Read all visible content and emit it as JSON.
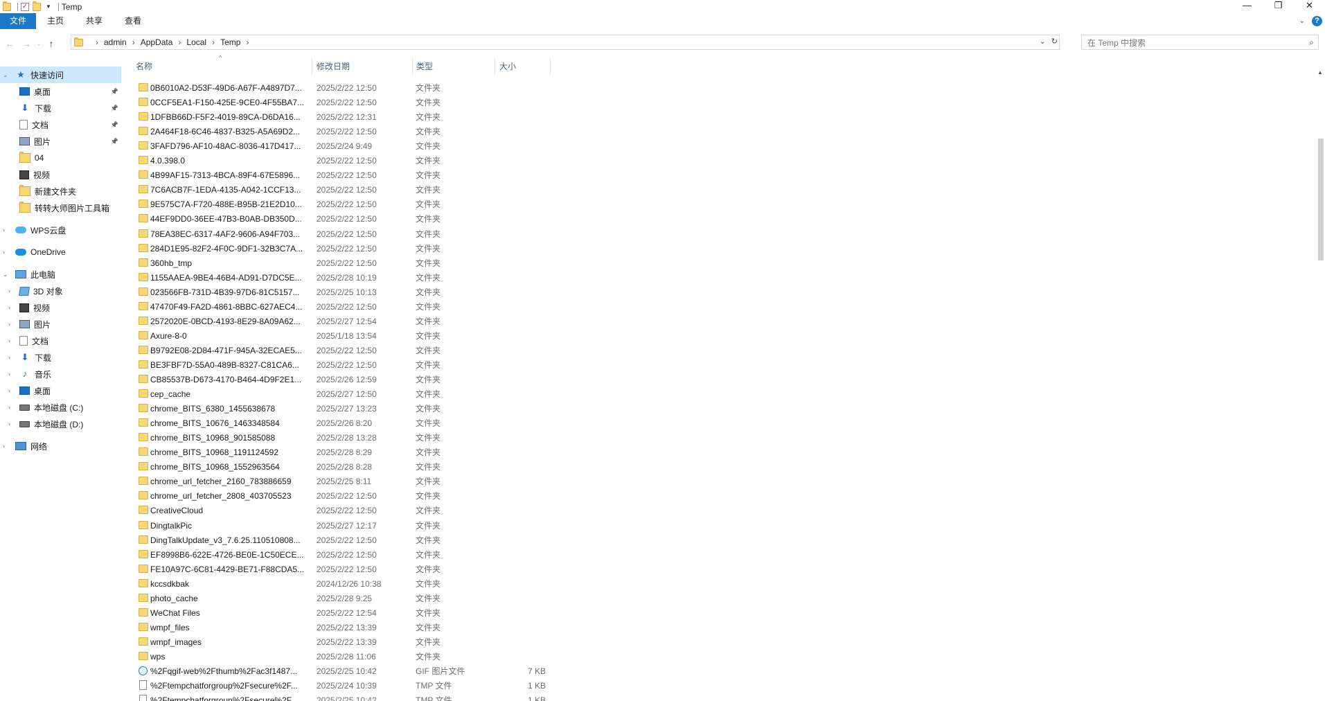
{
  "window": {
    "title": "Temp",
    "controls": [
      "—",
      "❐",
      "✕"
    ]
  },
  "ribbon": {
    "tabs": [
      "文件",
      "主页",
      "共享",
      "查看"
    ]
  },
  "address": {
    "crumbs": [
      "admin",
      "AppData",
      "Local",
      "Temp"
    ],
    "search_placeholder": "在 Temp 中搜索"
  },
  "sidebar": {
    "items": [
      {
        "label": "快速访问",
        "icon": "star-icon",
        "sel": true,
        "arrow": "down"
      },
      {
        "label": "桌面",
        "icon": "desktop-icon",
        "pin": true
      },
      {
        "label": "下载",
        "icon": "download-icon",
        "pin": true
      },
      {
        "label": "文档",
        "icon": "document-icon",
        "pin": true
      },
      {
        "label": "图片",
        "icon": "picture-icon",
        "pin": true
      },
      {
        "label": "04",
        "icon": "folder-icon"
      },
      {
        "label": "视频",
        "icon": "video-icon"
      },
      {
        "label": "新建文件夹",
        "icon": "folder-icon"
      },
      {
        "label": "转转大师图片工具箱",
        "icon": "folder-icon"
      },
      {
        "label": "WPS云盘",
        "icon": "wps-cloud-icon",
        "arrow": "right"
      },
      {
        "label": "OneDrive",
        "icon": "onedrive-icon",
        "arrow": "right"
      },
      {
        "label": "此电脑",
        "icon": "computer-icon",
        "arrow": "down"
      },
      {
        "label": "3D 对象",
        "icon": "3d-objects-icon",
        "arrow": "right"
      },
      {
        "label": "视频",
        "icon": "video-icon",
        "arrow": "right"
      },
      {
        "label": "图片",
        "icon": "picture-icon",
        "arrow": "right"
      },
      {
        "label": "文档",
        "icon": "document-icon",
        "arrow": "right"
      },
      {
        "label": "下载",
        "icon": "download-icon",
        "arrow": "right"
      },
      {
        "label": "音乐",
        "icon": "music-icon",
        "arrow": "right"
      },
      {
        "label": "桌面",
        "icon": "desktop-icon",
        "arrow": "right"
      },
      {
        "label": "本地磁盘 (C:)",
        "icon": "disk-icon",
        "arrow": "right"
      },
      {
        "label": "本地磁盘 (D:)",
        "icon": "disk-icon",
        "arrow": "right"
      },
      {
        "label": "网络",
        "icon": "network-icon",
        "arrow": "right"
      }
    ]
  },
  "columns": [
    "名称",
    "修改日期",
    "类型",
    "大小"
  ],
  "files": [
    {
      "name": "0B6010A2-D53F-49D6-A67F-A4897D7...",
      "date": "2025/2/22 12:50",
      "type": "文件夹",
      "size": "",
      "kind": "folder"
    },
    {
      "name": "0CCF5EA1-F150-425E-9CE0-4F55BA7...",
      "date": "2025/2/22 12:50",
      "type": "文件夹",
      "size": "",
      "kind": "folder"
    },
    {
      "name": "1DFBB66D-F5F2-4019-89CA-D6DA16...",
      "date": "2025/2/22 12:31",
      "type": "文件夹",
      "size": "",
      "kind": "folder"
    },
    {
      "name": "2A464F18-6C46-4837-B325-A5A69D2...",
      "date": "2025/2/22 12:50",
      "type": "文件夹",
      "size": "",
      "kind": "folder"
    },
    {
      "name": "3FAFD796-AF10-48AC-8036-417D417...",
      "date": "2025/2/24 9:49",
      "type": "文件夹",
      "size": "",
      "kind": "folder"
    },
    {
      "name": "4.0.398.0",
      "date": "2025/2/22 12:50",
      "type": "文件夹",
      "size": "",
      "kind": "folder"
    },
    {
      "name": "4B99AF15-7313-4BCA-89F4-67E5896...",
      "date": "2025/2/22 12:50",
      "type": "文件夹",
      "size": "",
      "kind": "folder"
    },
    {
      "name": "7C6ACB7F-1EDA-4135-A042-1CCF13...",
      "date": "2025/2/22 12:50",
      "type": "文件夹",
      "size": "",
      "kind": "folder"
    },
    {
      "name": "9E575C7A-F720-488E-B95B-21E2D10...",
      "date": "2025/2/22 12:50",
      "type": "文件夹",
      "size": "",
      "kind": "folder"
    },
    {
      "name": "44EF9DD0-36EE-47B3-B0AB-DB350D...",
      "date": "2025/2/22 12:50",
      "type": "文件夹",
      "size": "",
      "kind": "folder"
    },
    {
      "name": "78EA38EC-6317-4AF2-9606-A94F703...",
      "date": "2025/2/22 12:50",
      "type": "文件夹",
      "size": "",
      "kind": "folder"
    },
    {
      "name": "284D1E95-82F2-4F0C-9DF1-32B3C7A...",
      "date": "2025/2/22 12:50",
      "type": "文件夹",
      "size": "",
      "kind": "folder"
    },
    {
      "name": "360hb_tmp",
      "date": "2025/2/22 12:50",
      "type": "文件夹",
      "size": "",
      "kind": "folder"
    },
    {
      "name": "1155AAEA-9BE4-46B4-AD91-D7DC5E...",
      "date": "2025/2/28 10:19",
      "type": "文件夹",
      "size": "",
      "kind": "folder"
    },
    {
      "name": "023566FB-731D-4B39-97D6-81C5157...",
      "date": "2025/2/25 10:13",
      "type": "文件夹",
      "size": "",
      "kind": "folder"
    },
    {
      "name": "47470F49-FA2D-4861-8BBC-627AEC4...",
      "date": "2025/2/22 12:50",
      "type": "文件夹",
      "size": "",
      "kind": "folder"
    },
    {
      "name": "2572020E-0BCD-4193-8E29-8A09A62...",
      "date": "2025/2/27 12:54",
      "type": "文件夹",
      "size": "",
      "kind": "folder"
    },
    {
      "name": "Axure-8-0",
      "date": "2025/1/18 13:54",
      "type": "文件夹",
      "size": "",
      "kind": "folder"
    },
    {
      "name": "B9792E08-2D84-471F-945A-32ECAE5...",
      "date": "2025/2/22 12:50",
      "type": "文件夹",
      "size": "",
      "kind": "folder"
    },
    {
      "name": "BE3FBF7D-55A0-489B-8327-C81CA6...",
      "date": "2025/2/22 12:50",
      "type": "文件夹",
      "size": "",
      "kind": "folder"
    },
    {
      "name": "CB85537B-D673-4170-B464-4D9F2E1...",
      "date": "2025/2/26 12:59",
      "type": "文件夹",
      "size": "",
      "kind": "folder"
    },
    {
      "name": "cep_cache",
      "date": "2025/2/27 12:50",
      "type": "文件夹",
      "size": "",
      "kind": "folder"
    },
    {
      "name": "chrome_BITS_6380_1455638678",
      "date": "2025/2/27 13:23",
      "type": "文件夹",
      "size": "",
      "kind": "folder"
    },
    {
      "name": "chrome_BITS_10676_1463348584",
      "date": "2025/2/26 8:20",
      "type": "文件夹",
      "size": "",
      "kind": "folder"
    },
    {
      "name": "chrome_BITS_10968_901585088",
      "date": "2025/2/28 13:28",
      "type": "文件夹",
      "size": "",
      "kind": "folder"
    },
    {
      "name": "chrome_BITS_10968_1191124592",
      "date": "2025/2/28 8:29",
      "type": "文件夹",
      "size": "",
      "kind": "folder"
    },
    {
      "name": "chrome_BITS_10968_1552963564",
      "date": "2025/2/28 8:28",
      "type": "文件夹",
      "size": "",
      "kind": "folder"
    },
    {
      "name": "chrome_url_fetcher_2160_783886659",
      "date": "2025/2/25 8:11",
      "type": "文件夹",
      "size": "",
      "kind": "folder"
    },
    {
      "name": "chrome_url_fetcher_2808_403705523",
      "date": "2025/2/22 12:50",
      "type": "文件夹",
      "size": "",
      "kind": "folder"
    },
    {
      "name": "CreativeCloud",
      "date": "2025/2/22 12:50",
      "type": "文件夹",
      "size": "",
      "kind": "folder"
    },
    {
      "name": "DingtalkPic",
      "date": "2025/2/27 12:17",
      "type": "文件夹",
      "size": "",
      "kind": "folder"
    },
    {
      "name": "DingTalkUpdate_v3_7.6.25.110510808...",
      "date": "2025/2/22 12:50",
      "type": "文件夹",
      "size": "",
      "kind": "folder"
    },
    {
      "name": "EF8998B6-622E-4726-BE0E-1C50ECE...",
      "date": "2025/2/22 12:50",
      "type": "文件夹",
      "size": "",
      "kind": "folder"
    },
    {
      "name": "FE10A97C-6C81-4429-BE71-F88CDA5...",
      "date": "2025/2/22 12:50",
      "type": "文件夹",
      "size": "",
      "kind": "folder"
    },
    {
      "name": "kccsdkbak",
      "date": "2024/12/26 10:38",
      "type": "文件夹",
      "size": "",
      "kind": "folder"
    },
    {
      "name": "photo_cache",
      "date": "2025/2/28 9:25",
      "type": "文件夹",
      "size": "",
      "kind": "folder"
    },
    {
      "name": "WeChat Files",
      "date": "2025/2/22 12:54",
      "type": "文件夹",
      "size": "",
      "kind": "folder"
    },
    {
      "name": "wmpf_files",
      "date": "2025/2/22 13:39",
      "type": "文件夹",
      "size": "",
      "kind": "folder"
    },
    {
      "name": "wmpf_images",
      "date": "2025/2/22 13:39",
      "type": "文件夹",
      "size": "",
      "kind": "folder"
    },
    {
      "name": "wps",
      "date": "2025/2/28 11:06",
      "type": "文件夹",
      "size": "",
      "kind": "folder"
    },
    {
      "name": "%2Fqgif-web%2Fthumb%2Fac3f1487...",
      "date": "2025/2/25 10:42",
      "type": "GIF 图片文件",
      "size": "7 KB",
      "kind": "gif"
    },
    {
      "name": "%2Ftempchatforgroup%2Fsecure%2F...",
      "date": "2025/2/24 10:39",
      "type": "TMP 文件",
      "size": "1 KB",
      "kind": "tmp"
    },
    {
      "name": "%2Ftempchatforgroup%2Fsecure%2F...",
      "date": "2025/2/25 10:42",
      "type": "TMP 文件",
      "size": "1 KB",
      "kind": "tmp"
    }
  ]
}
